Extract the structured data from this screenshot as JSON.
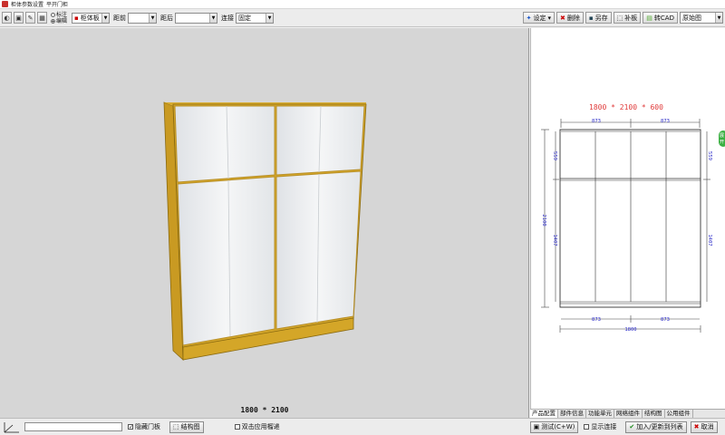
{
  "titlebar": {
    "title": "柜体参数设置",
    "subtitle": "平开门柜"
  },
  "toolbar": {
    "radio_top": "标注",
    "radio_bottom": "编辑",
    "component_select": "柜体板",
    "front_label": "距前",
    "front_value": "",
    "back_label": "距后",
    "back_value": "",
    "connect_label": "连接",
    "connect_value": "固定",
    "settings_label": "设定",
    "delete_label": "删除",
    "save_as_label": "另存",
    "patch_label": "补板",
    "to_cad_label": "转CAD",
    "view_select": "原始图"
  },
  "viewport": {
    "dimension_label": "1800 * 2100"
  },
  "drawing": {
    "title": "1800 * 2100 * 600",
    "top_left_width": "873",
    "top_right_width": "873",
    "bottom_left_width": "873",
    "bottom_right_width": "873",
    "total_width": "1800",
    "total_height": "2100",
    "upper_left_height": "559",
    "upper_right_height": "559",
    "lower_left_height": "1407",
    "lower_right_height": "1407",
    "side_tab": "展开"
  },
  "tabs": [
    "产品配置",
    "部件信息",
    "功能单元",
    "网络组件",
    "结构图",
    "公用组件"
  ],
  "statusbar": {
    "hide_door_label": "隐藏门板",
    "structure_btn": "结构图",
    "double_click_label": "双击应用榴递",
    "test_btn": "测试(C+W)",
    "show_connect_label": "显示连接",
    "add_update_btn": "加入/更新到列表",
    "cancel_btn": "取消"
  },
  "colors": {
    "wood": "#d4a628",
    "panel": "#eceef0",
    "dim_blue": "#2a2ac8",
    "title_red": "#e03a3a"
  }
}
